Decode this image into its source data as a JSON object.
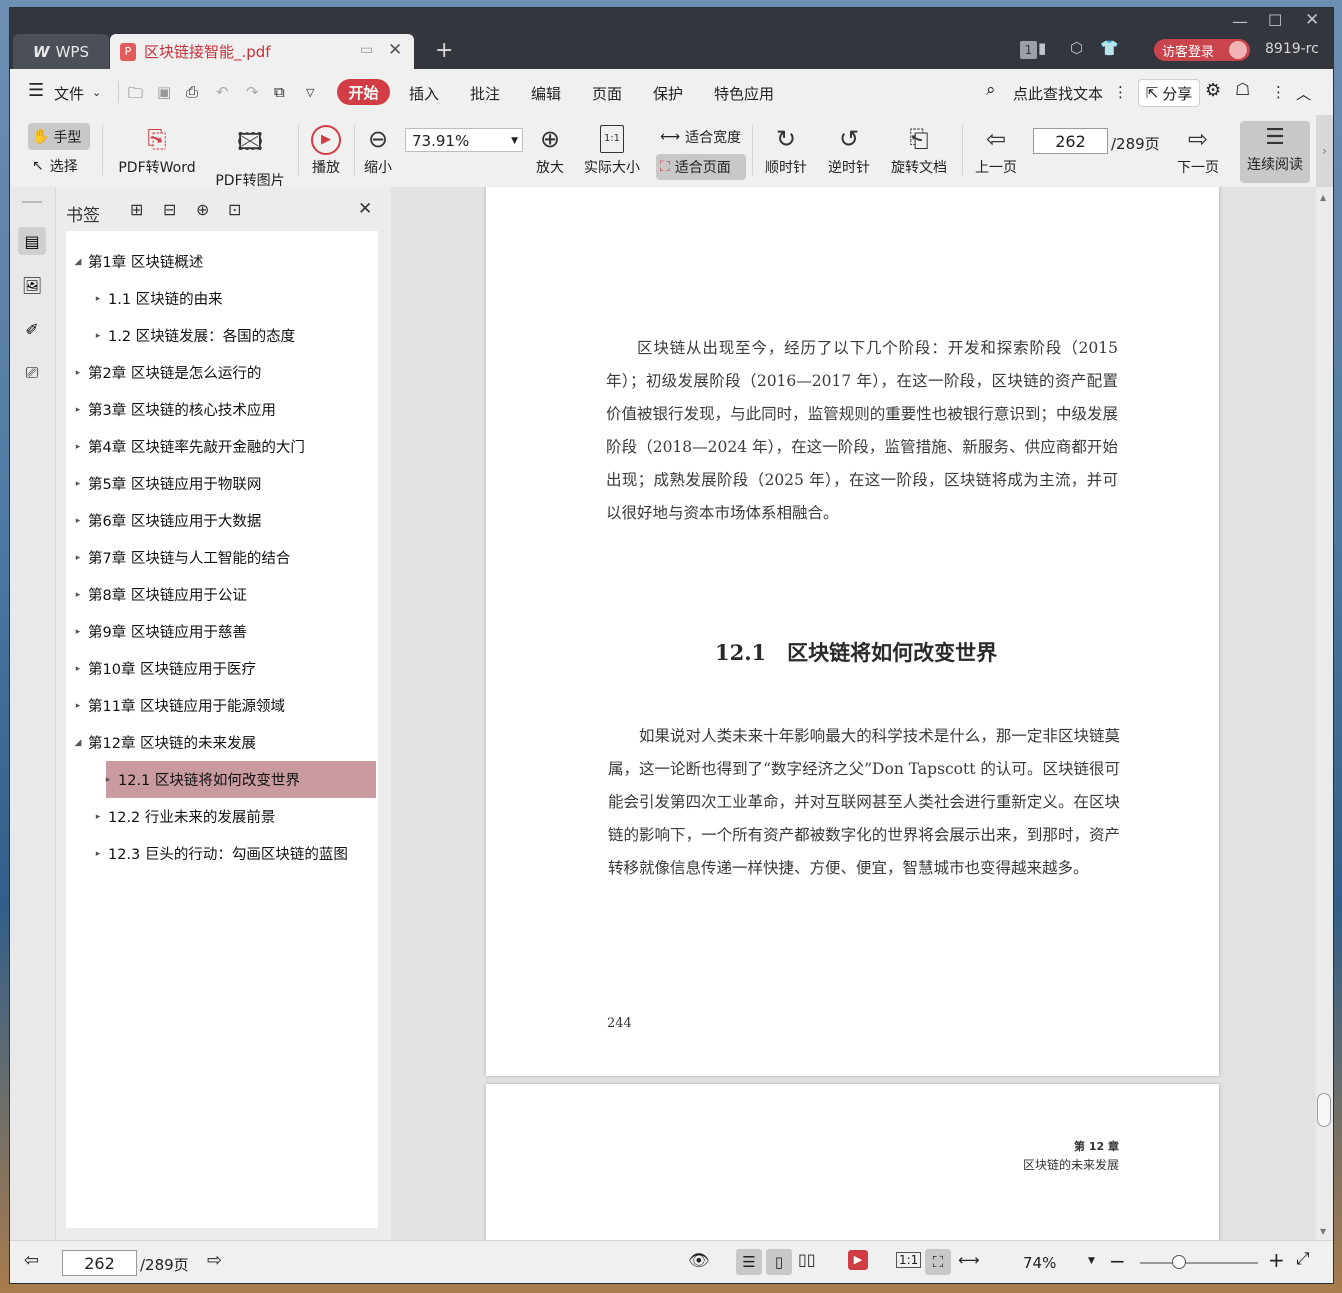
{
  "titlebar": {
    "wps_tab": "WPS",
    "doc_tab": "区块链接智能_.pdf",
    "badge_count": "1",
    "login_label": "访客登录",
    "user_name": "8919-rc"
  },
  "menu": {
    "file": "文件",
    "tabs": [
      "开始",
      "插入",
      "批注",
      "编辑",
      "页面",
      "保护",
      "特色应用"
    ],
    "active_tab": "开始",
    "search": "点此查找文本",
    "share": "分享"
  },
  "ribbon": {
    "hand": "手型",
    "select": "选择",
    "pdf_to_word": "PDF转Word",
    "pdf_to_image": "PDF转图片",
    "play": "播放",
    "zoom_out": "缩小",
    "zoom_value": "73.91%",
    "zoom_in": "放大",
    "actual_size": "实际大小",
    "fit_width": "适合宽度",
    "fit_page": "适合页面",
    "clockwise": "顺时针",
    "counterclockwise": "逆时针",
    "rotate_doc": "旋转文档",
    "prev_page": "上一页",
    "current_page": "262",
    "total_pages": "/289页",
    "next_page": "下一页",
    "continuous": "连续阅读"
  },
  "bookmarks": {
    "title": "书签",
    "items": [
      {
        "label": "第1章 区块链概述",
        "level": 0,
        "expanded": true
      },
      {
        "label": "1.1 区块链的由来",
        "level": 1
      },
      {
        "label": "1.2 区块链发展：各国的态度",
        "level": 1
      },
      {
        "label": "第2章 区块链是怎么运行的",
        "level": 0
      },
      {
        "label": "第3章 区块链的核心技术应用",
        "level": 0
      },
      {
        "label": "第4章 区块链率先敲开金融的大门",
        "level": 0
      },
      {
        "label": "第5章 区块链应用于物联网",
        "level": 0
      },
      {
        "label": "第6章 区块链应用于大数据",
        "level": 0
      },
      {
        "label": "第7章 区块链与人工智能的结合",
        "level": 0
      },
      {
        "label": "第8章 区块链应用于公证",
        "level": 0
      },
      {
        "label": "第9章 区块链应用于慈善",
        "level": 0
      },
      {
        "label": "第10章 区块链应用于医疗",
        "level": 0
      },
      {
        "label": "第11章 区块链应用于能源领域",
        "level": 0
      },
      {
        "label": "第12章 区块链的未来发展",
        "level": 0,
        "expanded": true
      },
      {
        "label": "12.1 区块链将如何改变世界",
        "level": 1,
        "selected": true
      },
      {
        "label": "12.2 行业未来的发展前景",
        "level": 1
      },
      {
        "label": "12.3 巨头的行动：勾画区块链的蓝图",
        "level": 1
      }
    ]
  },
  "page": {
    "para1": "区块链从出现至今，经历了以下几个阶段：开发和探索阶段（2015年）；初级发展阶段（2016—2017 年），在这一阶段，区块链的资产配置价值被银行发现，与此同时，监管规则的重要性也被银行意识到；中级发展阶段（2018—2024 年），在这一阶段，监管措施、新服务、供应商都开始出现；成熟发展阶段（2025 年），在这一阶段，区块链将成为主流，并可以很好地与资本市场体系相融合。",
    "heading": "12.1　区块链将如何改变世界",
    "para2": "如果说对人类未来十年影响最大的科学技术是什么，那一定非区块链莫属，这一论断也得到了“数字经济之父”Don Tapscott 的认可。区块链很可能会引发第四次工业革命，并对互联网甚至人类社会进行重新定义。在区块链的影响下，一个所有资产都被数字化的世界将会展示出来，到那时，资产转移就像信息传递一样快捷、方便、便宜，智慧城市也变得越来越多。",
    "page_number": "244",
    "next_chapter": "第 12 章",
    "next_chapter_title": "区块链的未来发展"
  },
  "status": {
    "current_page": "262",
    "total_pages": "/289页",
    "zoom": "74%"
  },
  "colors": {
    "accent": "#d23c45",
    "selected_bookmark": "#c99aa0",
    "titlebar": "#33363d"
  }
}
